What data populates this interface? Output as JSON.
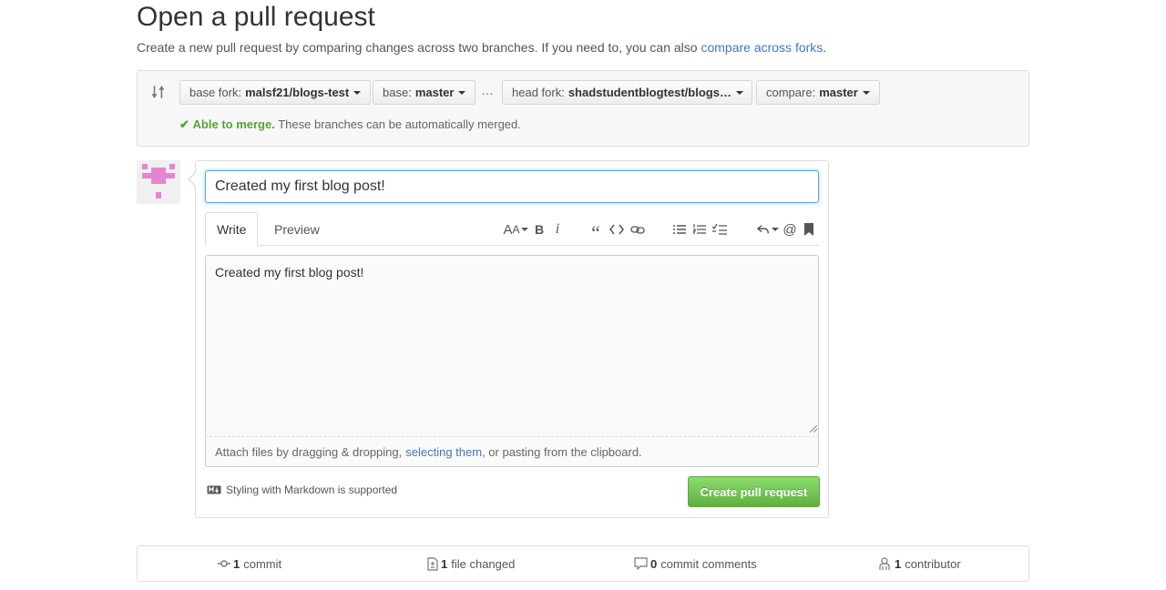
{
  "page": {
    "title": "Open a pull request",
    "subtitle": "Create a new pull request by comparing changes across two branches. If you need to, you can also",
    "subtitle_link": "compare across forks",
    "subtitle_end": "."
  },
  "range": {
    "base_fork_label": "base fork:",
    "base_fork_value": "malsf21/blogs-test",
    "base_label": "base:",
    "base_value": "master",
    "separator": "…",
    "head_fork_label": "head fork:",
    "head_fork_value": "shadstudentblogtest/blogs…",
    "compare_label": "compare:",
    "compare_value": "master",
    "merge_status_ok": "Able to merge.",
    "merge_status_text": "These branches can be automatically merged."
  },
  "form": {
    "title_value": "Created my first blog post!",
    "tabs": [
      {
        "label": "Write"
      },
      {
        "label": "Preview"
      }
    ],
    "toolbar_icons": [
      "text-size-icon",
      "bold-icon",
      "italic-icon",
      "quote-icon",
      "code-icon",
      "link-icon",
      "unordered-list-icon",
      "ordered-list-icon",
      "task-list-icon",
      "reply-icon",
      "mention-icon",
      "bookmark-icon"
    ],
    "body_value": "Created my first blog post!",
    "attach_prefix": "Attach files by dragging & dropping,",
    "attach_link": "selecting them",
    "attach_suffix": ", or pasting from the clipboard.",
    "markdown_note": "Styling with Markdown is supported",
    "submit_label": "Create pull request"
  },
  "stats": {
    "commits_count": "1",
    "commits_label": "commit",
    "files_count": "1",
    "files_label": "file changed",
    "comments_count": "0",
    "comments_label": "commit comments",
    "contributors_count": "1",
    "contributors_label": "contributor"
  },
  "colors": {
    "link": "#4078c0",
    "success": "#55a532",
    "button_green": "#60b044",
    "focus_blue": "#51a7e8",
    "avatar_pink": "#e585d2"
  }
}
